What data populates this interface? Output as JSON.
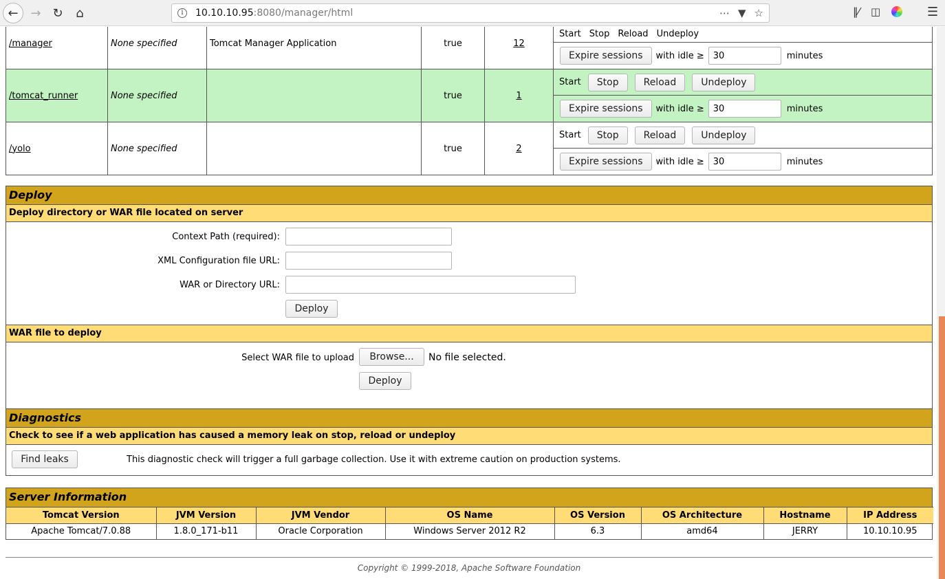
{
  "browser": {
    "url_host": "10.10.10.95",
    "url_rest": ":8080/manager/html"
  },
  "apps": [
    {
      "path": "/manager",
      "version": "None specified",
      "display_name": "Tomcat Manager Application",
      "running": "true",
      "sessions": "12",
      "commands": [
        "Start",
        "Stop",
        "Reload",
        "Undeploy"
      ],
      "idle": "30"
    },
    {
      "path": "/tomcat_runner",
      "version": "None specified",
      "display_name": "",
      "running": "true",
      "sessions": "1",
      "commands": [
        "Start",
        "Stop",
        "Reload",
        "Undeploy"
      ],
      "idle": "30"
    },
    {
      "path": "/yolo",
      "version": "None specified",
      "display_name": "",
      "running": "true",
      "sessions": "2",
      "commands": [
        "Start",
        "Stop",
        "Reload",
        "Undeploy"
      ],
      "idle": "30"
    }
  ],
  "labels": {
    "expire_sessions": "Expire sessions",
    "with_idle": "with idle ≥",
    "minutes": "minutes"
  },
  "deploy": {
    "title": "Deploy",
    "subtitle": "Deploy directory or WAR file located on server",
    "context_path_label": "Context Path (required):",
    "xml_config_label": "XML Configuration file URL:",
    "war_dir_label": "WAR or Directory URL:",
    "deploy_button": "Deploy",
    "war_subtitle": "WAR file to deploy",
    "select_war_label": "Select WAR file to upload",
    "browse_button": "Browse...",
    "no_file": "No file selected.",
    "war_deploy_button": "Deploy"
  },
  "diagnostics": {
    "title": "Diagnostics",
    "subtitle": "Check to see if a web application has caused a memory leak on stop, reload or undeploy",
    "find_leaks_button": "Find leaks",
    "description": "This diagnostic check will trigger a full garbage collection. Use it with extreme caution on production systems."
  },
  "server_info": {
    "title": "Server Information",
    "headers": [
      "Tomcat Version",
      "JVM Version",
      "JVM Vendor",
      "OS Name",
      "OS Version",
      "OS Architecture",
      "Hostname",
      "IP Address"
    ],
    "values": [
      "Apache Tomcat/7.0.88",
      "1.8.0_171-b11",
      "Oracle Corporation",
      "Windows Server 2012 R2",
      "6.3",
      "amd64",
      "JERRY",
      "10.10.10.95"
    ]
  },
  "footer": "Copyright © 1999-2018, Apache Software Foundation"
}
